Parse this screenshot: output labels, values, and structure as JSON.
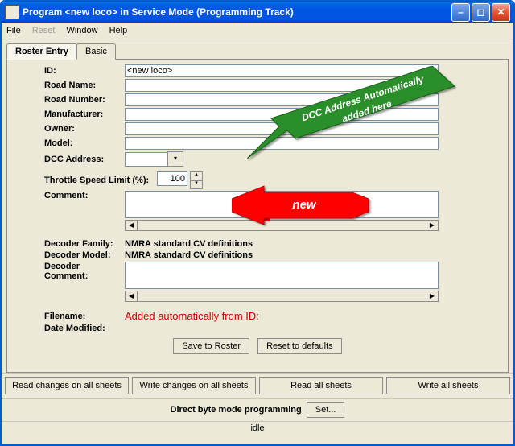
{
  "window": {
    "title": "Program <new loco> in Service Mode (Programming Track)"
  },
  "menu": {
    "file": "File",
    "reset": "Reset",
    "window": "Window",
    "help": "Help"
  },
  "tabs": {
    "roster": "Roster Entry",
    "basic": "Basic"
  },
  "labels": {
    "id": "ID:",
    "road_name": "Road Name:",
    "road_number": "Road Number:",
    "manufacturer": "Manufacturer:",
    "owner": "Owner:",
    "model": "Model:",
    "dcc_address": "DCC Address:",
    "throttle": "Throttle Speed Limit (%):",
    "comment": "Comment:",
    "decoder_family": "Decoder Family:",
    "decoder_model": "Decoder Model:",
    "decoder_comment": "Decoder Comment:",
    "filename": "Filename:",
    "date_modified": "Date Modified:"
  },
  "values": {
    "id": "<new loco>",
    "throttle": "100",
    "decoder_family": "NMRA standard CV definitions",
    "decoder_model": "NMRA standard CV definitions",
    "filename_note": "Added automatically from ID:"
  },
  "buttons": {
    "save": "Save to Roster",
    "reset_defaults": "Reset to defaults",
    "read_changes": "Read changes on all sheets",
    "write_changes": "Write changes on all sheets",
    "read_all": "Read all sheets",
    "write_all": "Write all sheets",
    "set": "Set..."
  },
  "prog_mode": "Direct byte mode programming",
  "status": "idle",
  "annotations": {
    "green": "DCC Address Automatically added here",
    "red": "new"
  }
}
